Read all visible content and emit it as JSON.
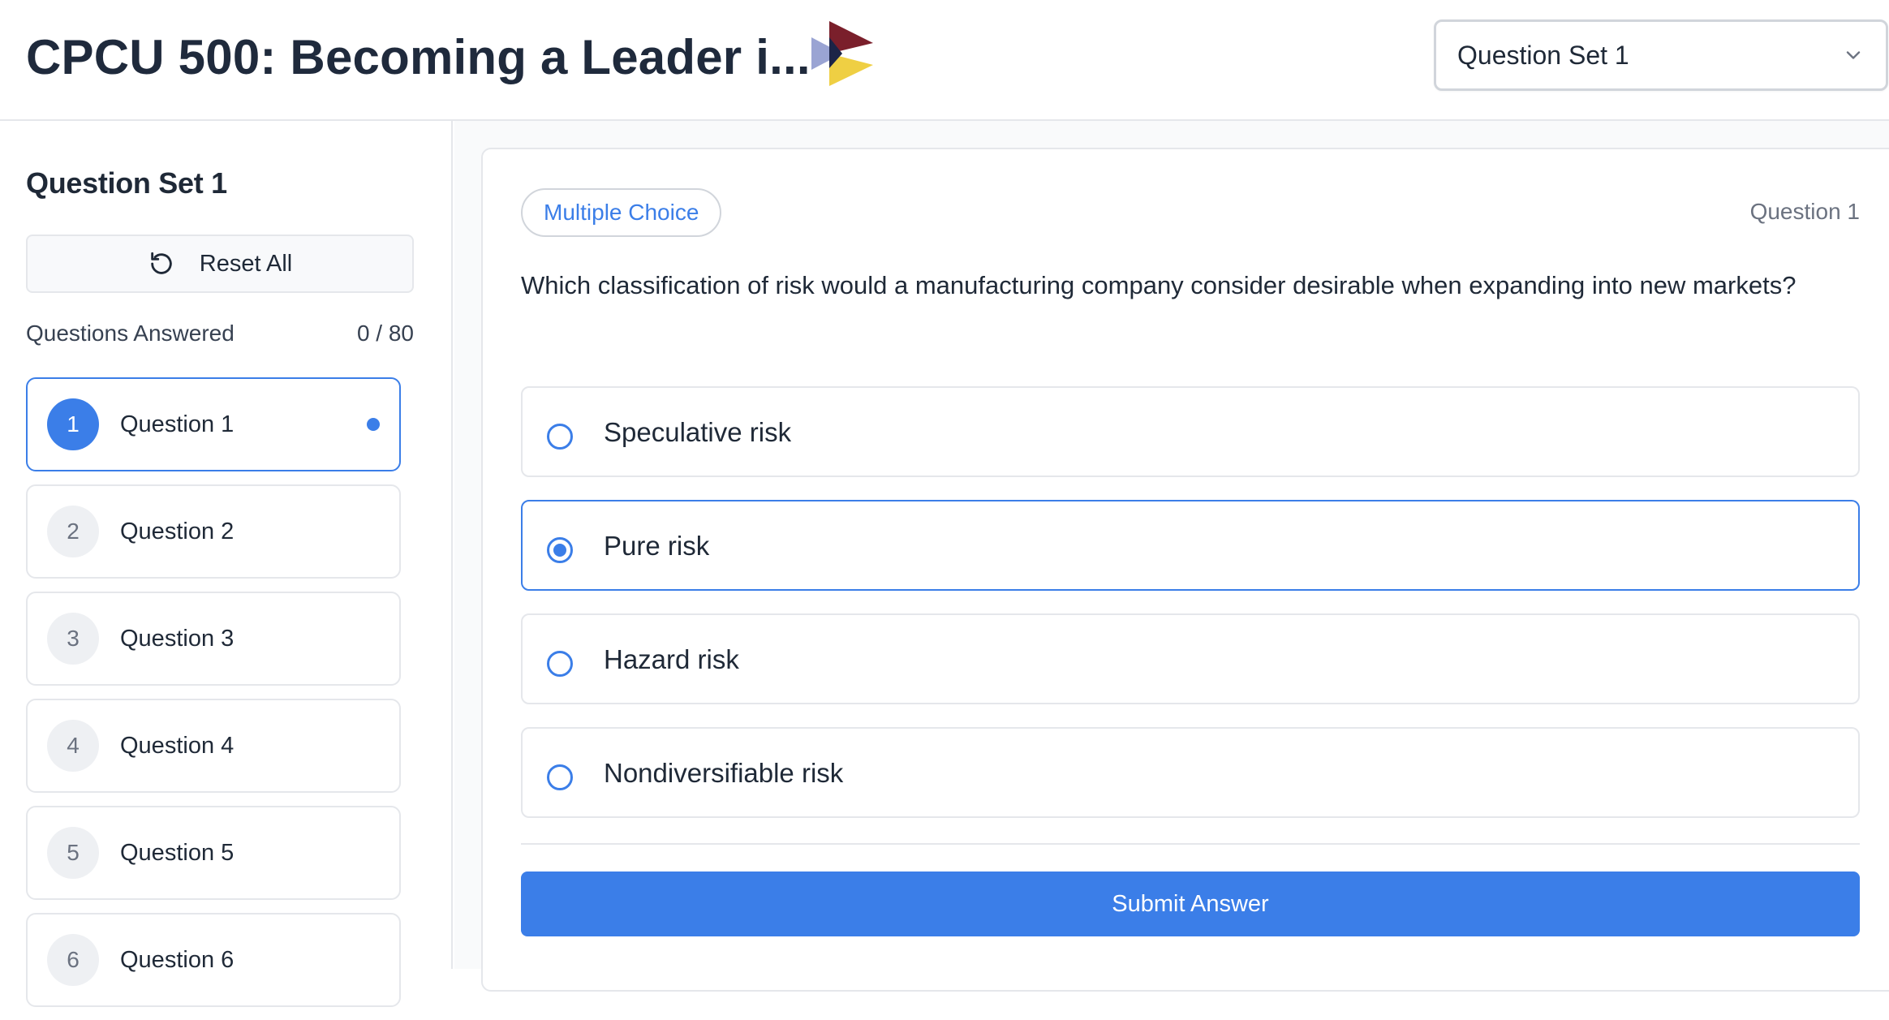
{
  "header": {
    "title": "CPCU 500: Becoming a Leader i...",
    "set_select": {
      "value": "Question Set 1"
    }
  },
  "sidebar": {
    "title": "Question Set 1",
    "reset_label": "Reset All",
    "progress_label": "Questions Answered",
    "progress_value": "0 / 80",
    "questions": [
      {
        "num": "1",
        "label": "Question 1",
        "active": true
      },
      {
        "num": "2",
        "label": "Question 2",
        "active": false
      },
      {
        "num": "3",
        "label": "Question 3",
        "active": false
      },
      {
        "num": "4",
        "label": "Question 4",
        "active": false
      },
      {
        "num": "5",
        "label": "Question 5",
        "active": false
      },
      {
        "num": "6",
        "label": "Question 6",
        "active": false
      }
    ]
  },
  "question": {
    "type": "Multiple Choice",
    "counter": "Question 1",
    "text": "Which classification of risk would a manufacturing company consider desirable when expanding into new markets?",
    "options": [
      {
        "label": "Speculative risk",
        "selected": false
      },
      {
        "label": "Pure risk",
        "selected": true
      },
      {
        "label": "Hazard risk",
        "selected": false
      },
      {
        "label": "Nondiversifiable risk",
        "selected": false
      }
    ],
    "submit_label": "Submit Answer"
  },
  "colors": {
    "accent": "#3b7ee8",
    "title_text": "#1f2a3c",
    "border": "#e5e7eb",
    "logo_dark_red": "#7a1f2b",
    "logo_navy": "#1c2447",
    "logo_lavender": "#9aa4d3",
    "logo_yellow": "#efcf43"
  },
  "icons": {
    "logo": "play-triangle-logo",
    "select_chevron": "chevron-down-icon",
    "reset": "rotate-ccw-icon"
  }
}
